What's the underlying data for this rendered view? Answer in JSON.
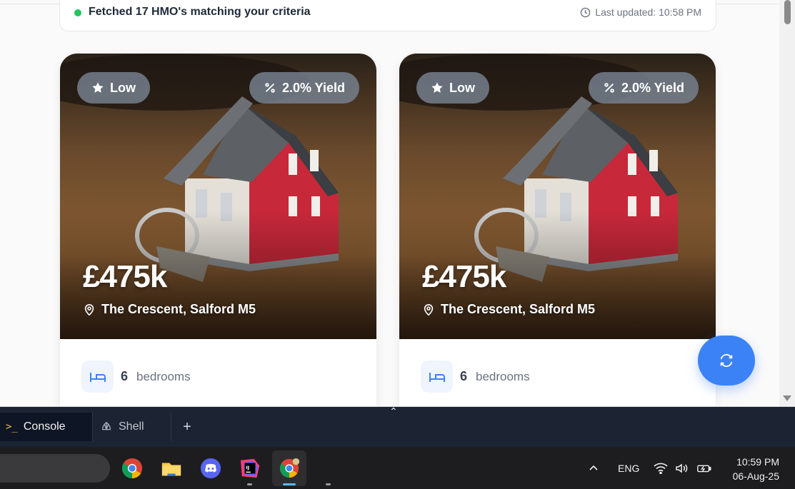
{
  "status": {
    "message": "Fetched 17 HMO's matching your criteria",
    "last_updated": "Last updated: 10:58 PM"
  },
  "cards": [
    {
      "rating": "Low",
      "yield": "2.0% Yield",
      "price": "£475k",
      "address": "The Crescent, Salford M5",
      "bedrooms": "6",
      "bedrooms_label": "bedrooms"
    },
    {
      "rating": "Low",
      "yield": "2.0% Yield",
      "price": "£475k",
      "address": "The Crescent, Salford M5",
      "bedrooms": "6",
      "bedrooms_label": "bedrooms"
    }
  ],
  "console": {
    "tabs": [
      {
        "label": "Console",
        "icon": "terminal-prompt-icon"
      },
      {
        "label": "Shell",
        "icon": "shell-icon"
      }
    ],
    "add_label": "+"
  },
  "taskbar": {
    "apps": [
      "chrome-icon",
      "file-explorer-icon",
      "discord-icon",
      "intellij-icon",
      "chrome-profile-icon"
    ],
    "language": "ENG",
    "time": "10:59 PM",
    "date": "06-Aug-25"
  },
  "colors": {
    "accent": "#3b82f6",
    "status_dot": "#22c55e",
    "console_bg": "#1c2333",
    "taskbar_bg": "#1d1d1f"
  }
}
